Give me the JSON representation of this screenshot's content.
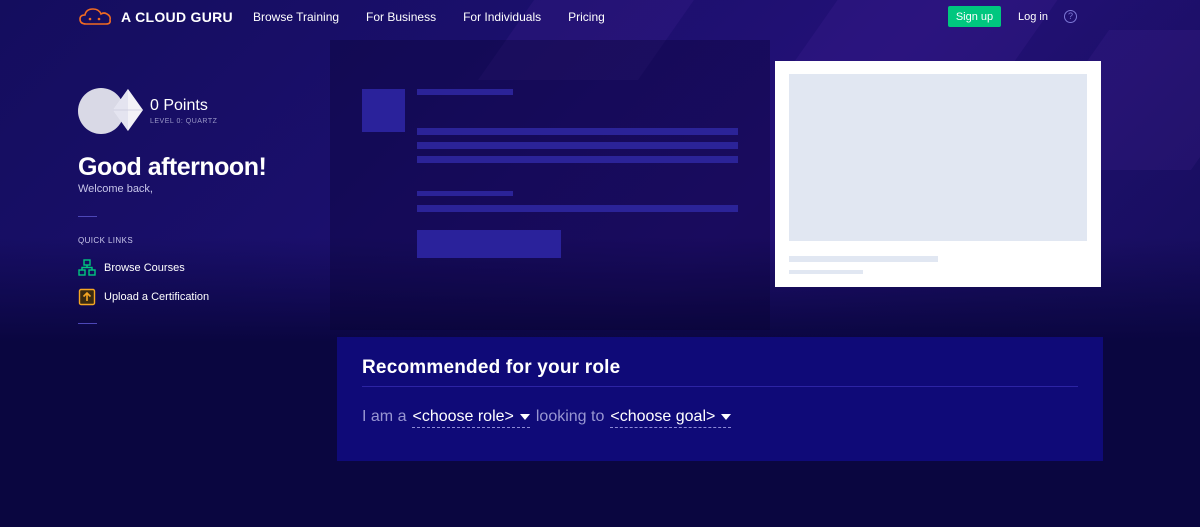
{
  "header": {
    "brand": "A CLOUD GURU",
    "nav": [
      {
        "label": "Browse Training"
      },
      {
        "label": "For Business"
      },
      {
        "label": "For Individuals"
      },
      {
        "label": "Pricing"
      }
    ],
    "signup_label": "Sign up",
    "login_label": "Log in",
    "help_glyph": "?"
  },
  "profile": {
    "points": "0 Points",
    "level": "LEVEL 0: QUARTZ"
  },
  "greeting": {
    "title": "Good afternoon!",
    "subtitle": "Welcome back,"
  },
  "quick_links": {
    "title": "QUICK LINKS",
    "items": [
      {
        "label": "Browse Courses",
        "icon": "sitemap-icon",
        "color": "#00c77f"
      },
      {
        "label": "Upload a Certification",
        "icon": "upload-certificate-icon",
        "color": "#f5a623"
      }
    ]
  },
  "recommended": {
    "title": "Recommended for your role",
    "prefix": "I am a",
    "role_select": "<choose role>",
    "middle": "looking to",
    "goal_select": "<choose goal>"
  },
  "colors": {
    "brand_orange": "#f26b21",
    "accent_green": "#00c77f",
    "background": "#0a0640",
    "panel": "#0f0a78"
  }
}
